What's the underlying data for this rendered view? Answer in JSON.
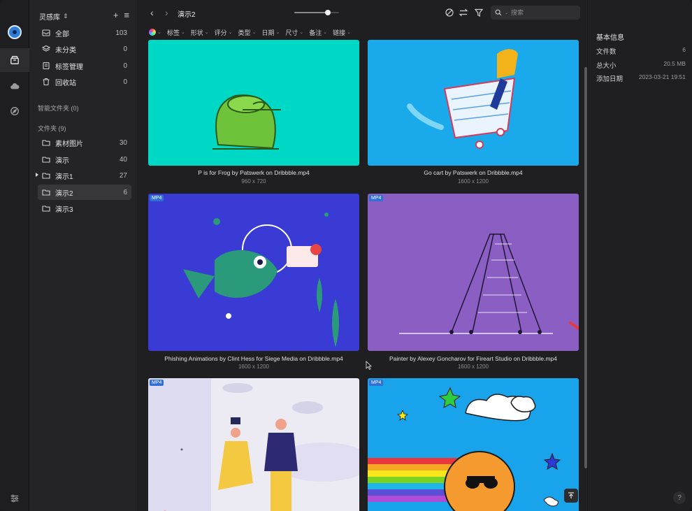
{
  "sidebar": {
    "library_title": "灵感库",
    "library_chevron": "⇕",
    "add_icon": "plus-icon",
    "menu_icon": "hamburger-icon",
    "main_items": [
      {
        "label": "全部",
        "count": "103",
        "icon": "inbox-icon"
      },
      {
        "label": "未分类",
        "count": "0",
        "icon": "layers-icon"
      },
      {
        "label": "标签管理",
        "count": "0",
        "icon": "tag-icon"
      },
      {
        "label": "回收站",
        "count": "0",
        "icon": "trash-icon"
      }
    ],
    "smart_folders": "智能文件夹 (0)",
    "folders_header": "文件夹 (9)",
    "folders": [
      {
        "label": "素材图片",
        "count": "30"
      },
      {
        "label": "演示",
        "count": "40"
      },
      {
        "label": "演示1",
        "count": "27"
      },
      {
        "label": "演示2",
        "count": "6"
      },
      {
        "label": "演示3",
        "count": ""
      }
    ]
  },
  "topbar": {
    "title": "演示2",
    "zoom_level": 0.75,
    "search_placeholder": "搜索"
  },
  "filters": [
    "标签",
    "形状",
    "评分",
    "类型",
    "日期",
    "尺寸",
    "备注",
    "链接"
  ],
  "cards": [
    {
      "name": "P is for Frog by Patswerk on Dribbble.mp4",
      "dims": "960 x 720",
      "badge": "",
      "bg": "#00d8c6"
    },
    {
      "name": "Go cart by Patswerk on Dribbble.mp4",
      "dims": "1600 x 1200",
      "badge": "",
      "bg": "#1aa9ea"
    },
    {
      "name": "Phishing Animations by Clint Hess for Siege Media on Dribbble.mp4",
      "dims": "1600 x 1200",
      "badge": "MP4",
      "bg": "#3a3ad4"
    },
    {
      "name": "Painter by Alexey Goncharov for Fireart Studio on Dribbble.mp4",
      "dims": "1600 x 1200",
      "badge": "MP4",
      "bg": "#8a5ec2"
    },
    {
      "name": "",
      "dims": "",
      "badge": "MP4",
      "bg": "#ecebf4"
    },
    {
      "name": "",
      "dims": "",
      "badge": "MP4",
      "bg": "#19a3ea"
    }
  ],
  "inspector": {
    "title": "基本信息",
    "rows": [
      {
        "key": "文件数",
        "value": "6"
      },
      {
        "key": "总大小",
        "value": "20.5 MB"
      },
      {
        "key": "添加日期",
        "value": "2023-03-21 19:51"
      }
    ],
    "help": "?"
  }
}
